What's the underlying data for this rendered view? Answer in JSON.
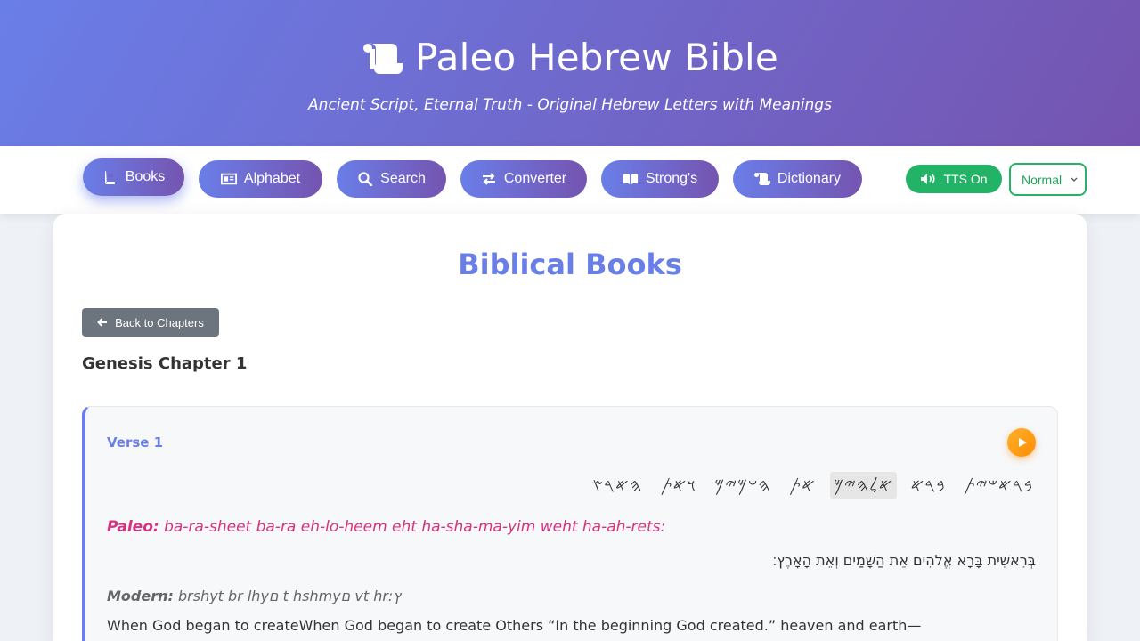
{
  "header": {
    "title": "Paleo Hebrew Bible",
    "subtitle": "Ancient Script, Eternal Truth - Original Hebrew Letters with Meanings",
    "logo_icon": "scroll-icon"
  },
  "nav": {
    "items": [
      {
        "label": "Books",
        "icon": "book-icon",
        "active": true
      },
      {
        "label": "Alphabet",
        "icon": "id-card-icon"
      },
      {
        "label": "Search",
        "icon": "search-icon"
      },
      {
        "label": "Converter",
        "icon": "exchange-icon"
      },
      {
        "label": "Strong's",
        "icon": "open-book-icon"
      },
      {
        "label": "Dictionary",
        "icon": "scroll-icon"
      }
    ],
    "tts_label": "TTS On",
    "speed_value": "Normal"
  },
  "main": {
    "title": "Biblical Books",
    "back_label": "Back to Chapters",
    "chapter_title": "Genesis Chapter 1",
    "verse": {
      "label": "Verse 1",
      "paleo_words": [
        "𐤁𐤓𐤀𐤔𐤉𐤕",
        "𐤁𐤓𐤀",
        "𐤀𐤋𐤄𐤉𐤌",
        "𐤀𐤕",
        "𐤄𐤔𐤌𐤉𐤌",
        "𐤅𐤀𐤕",
        "𐤄𐤀𐤓𐤑"
      ],
      "highlighted_word_index": 2,
      "paleo_prefix": "Paleo:",
      "paleo_translit": "ba-ra-sheet ba-ra eh-lo-heem eht ha-sha-ma-yim weht ha-ah-rets:",
      "hebrew": "בְּרֵאשִׁית בָּרָא אֱלֹהִים אֵת הַשָּׁמַיִם וְאֵת הָאָרֶץ׃",
      "modern_prefix": "Modern:",
      "modern_translit": "brshyt br lhyם t hshmyם vt hr:ץ",
      "english": "When God began to createWhen God began to create Others “In the beginning God created.” heaven and earth—"
    }
  },
  "colors": {
    "accent": "#6a7ee8",
    "accent_dark": "#7554b0",
    "tts_green": "#22b366",
    "translit_pink": "#d6337f",
    "play_orange": "#ff9f1c"
  }
}
